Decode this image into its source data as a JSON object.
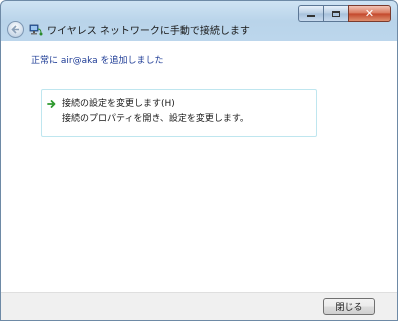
{
  "window": {
    "title": "ワイヤレス ネットワークに手動で接続します",
    "controls": {
      "minimize_icon": "minimize-icon",
      "maximize_icon": "maximize-icon",
      "close_icon": "close-icon"
    }
  },
  "status": {
    "text": "正常に air@aka を追加しました",
    "color": "#1e3c96"
  },
  "option": {
    "title": "接続の設定を変更します(H)",
    "description": "接続のプロパティを開き、設定を変更します。",
    "icon": "green-arrow-icon"
  },
  "footer": {
    "close_label": "閉じる"
  }
}
